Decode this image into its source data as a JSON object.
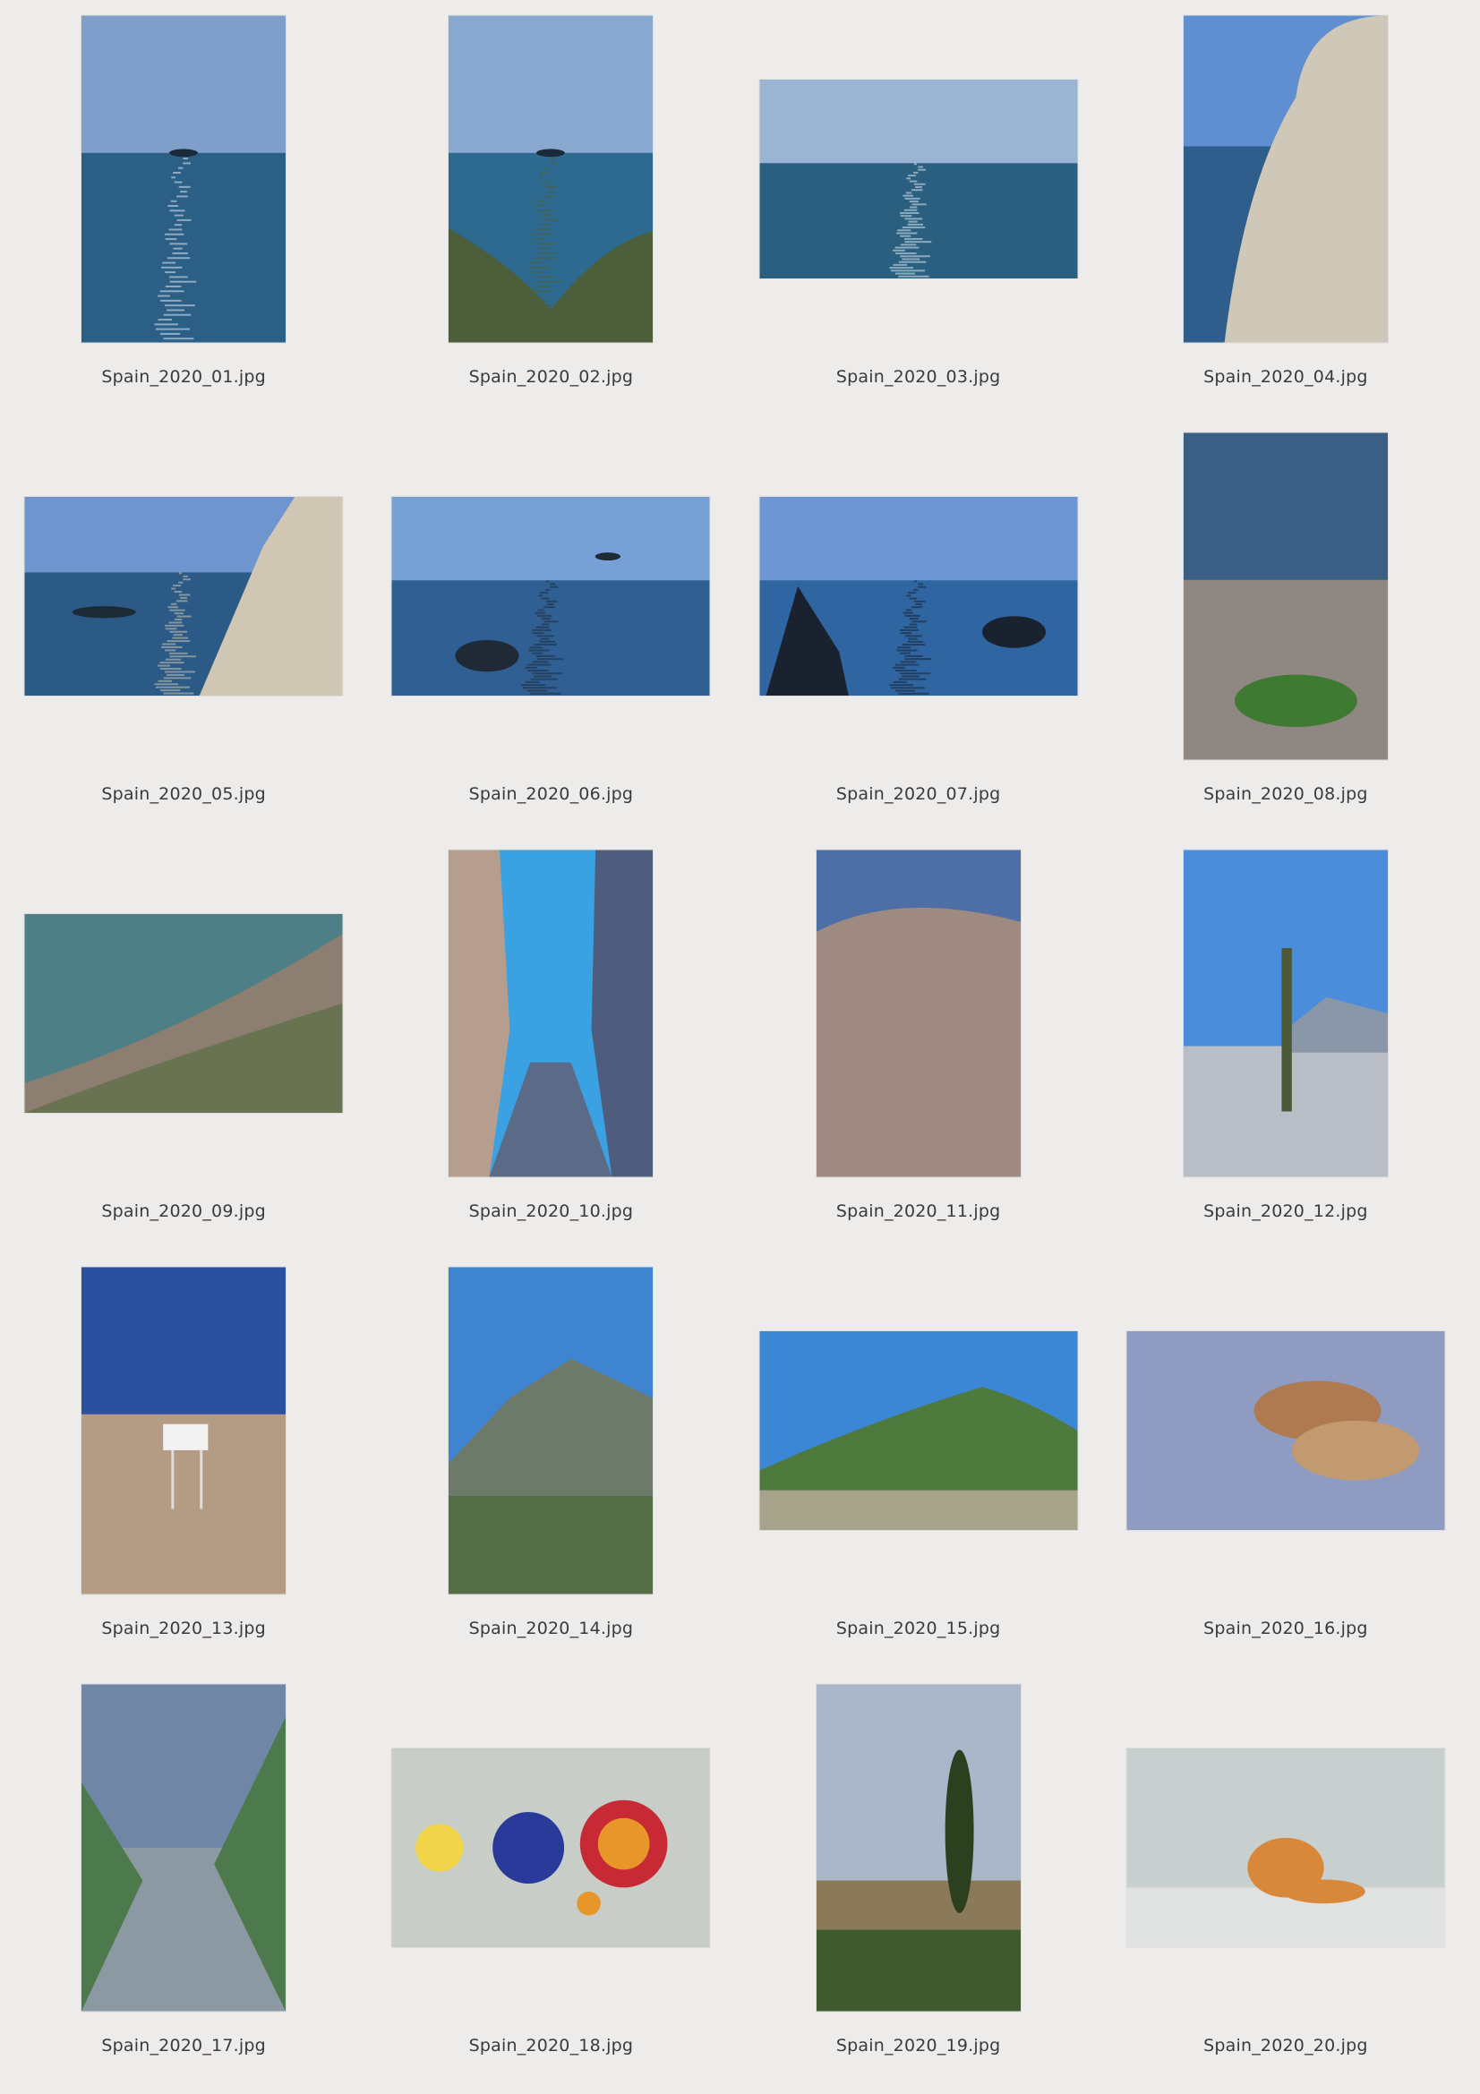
{
  "contact_sheet": {
    "photos": [
      {
        "filename": "Spain_2020_01.jpg",
        "orientation": "portrait",
        "scene": "sea-glitter-islet",
        "colors": {
          "sky": "#7f9ec9",
          "main": "#2c5f86",
          "accent": "#dfe8f4"
        }
      },
      {
        "filename": "Spain_2020_02.jpg",
        "orientation": "portrait",
        "scene": "sea-islet-hills",
        "colors": {
          "sky": "#88a8cf",
          "main": "#2e6a8f",
          "accent": "#4c5f3a"
        }
      },
      {
        "filename": "Spain_2020_03.jpg",
        "orientation": "landscape",
        "scene": "sea-glitter",
        "colors": {
          "sky": "#9ab4d4",
          "main": "#2a5f7f",
          "accent": "#dde8f2"
        }
      },
      {
        "filename": "Spain_2020_04.jpg",
        "orientation": "portrait",
        "scene": "cliff-right",
        "colors": {
          "sky": "#5f8fd0",
          "main": "#2f5d8c",
          "accent": "#cfc8b8"
        }
      },
      {
        "filename": "Spain_2020_05.jpg",
        "orientation": "landscape",
        "scene": "coast-cliff",
        "colors": {
          "sky": "#6f95cf",
          "main": "#2b5a86",
          "accent": "#cfc6b3"
        }
      },
      {
        "filename": "Spain_2020_06.jpg",
        "orientation": "landscape",
        "scene": "sea-rocks",
        "colors": {
          "sky": "#77a0d6",
          "main": "#2f5f93",
          "accent": "#1f2a36"
        }
      },
      {
        "filename": "Spain_2020_07.jpg",
        "orientation": "landscape",
        "scene": "sea-seastacks",
        "colors": {
          "sky": "#6d97d4",
          "main": "#2f65a0",
          "accent": "#1a2230"
        }
      },
      {
        "filename": "Spain_2020_08.jpg",
        "orientation": "portrait",
        "scene": "beach-shrub",
        "colors": {
          "sky": "#3b5f84",
          "main": "#8e8782",
          "accent": "#3f7a32"
        }
      },
      {
        "filename": "Spain_2020_09.jpg",
        "orientation": "landscape",
        "scene": "bay-beach",
        "colors": {
          "sky": "#4f7f86",
          "main": "#8c7e70",
          "accent": "#e6eef3"
        }
      },
      {
        "filename": "Spain_2020_10.jpg",
        "orientation": "portrait",
        "scene": "canyon-path",
        "colors": {
          "sky": "#3aa1e2",
          "main": "#4e5d7e",
          "accent": "#b59e8e"
        }
      },
      {
        "filename": "Spain_2020_11.jpg",
        "orientation": "portrait",
        "scene": "rock-wall",
        "colors": {
          "sky": "#4d6fa6",
          "main": "#9e8a80",
          "accent": "#6f6058"
        }
      },
      {
        "filename": "Spain_2020_12.jpg",
        "orientation": "portrait",
        "scene": "palm-desert",
        "colors": {
          "sky": "#4a8edb",
          "main": "#b8bdc6",
          "accent": "#4c5a3a"
        }
      },
      {
        "filename": "Spain_2020_13.jpg",
        "orientation": "portrait",
        "scene": "sign-scrub",
        "colors": {
          "sky": "#2b50a0",
          "main": "#b49c84",
          "accent": "#f2f2f2"
        }
      },
      {
        "filename": "Spain_2020_14.jpg",
        "orientation": "portrait",
        "scene": "mountain-scrub",
        "colors": {
          "sky": "#3f84d0",
          "main": "#6d7a6a",
          "accent": "#4f6b3f"
        }
      },
      {
        "filename": "Spain_2020_15.jpg",
        "orientation": "landscape",
        "scene": "green-hill",
        "colors": {
          "sky": "#3c86d6",
          "main": "#4e7a3e",
          "accent": "#a6a38a"
        }
      },
      {
        "filename": "Spain_2020_16.jpg",
        "orientation": "landscape",
        "scene": "shoes",
        "colors": {
          "sky": "#6f7f9f",
          "main": "#8f9bc0",
          "accent": "#b07a50"
        }
      },
      {
        "filename": "Spain_2020_17.jpg",
        "orientation": "portrait",
        "scene": "reed-path",
        "colors": {
          "sky": "#6f86a6",
          "main": "#8c99a3",
          "accent": "#4c7a4c"
        }
      },
      {
        "filename": "Spain_2020_18.jpg",
        "orientation": "landscape",
        "scene": "fruit-bowls",
        "colors": {
          "sky": "#d9dcd8",
          "main": "#c8cdc8",
          "accent": "#e8962a"
        }
      },
      {
        "filename": "Spain_2020_19.jpg",
        "orientation": "portrait",
        "scene": "cypress-ruin",
        "colors": {
          "sky": "#aab6c9",
          "main": "#8a7a5a",
          "accent": "#3f5a2c"
        }
      },
      {
        "filename": "Spain_2020_20.jpg",
        "orientation": "landscape",
        "scene": "cat-wall",
        "colors": {
          "sky": "#d6dad8",
          "main": "#c7cfcf",
          "accent": "#d8883a"
        }
      }
    ]
  }
}
